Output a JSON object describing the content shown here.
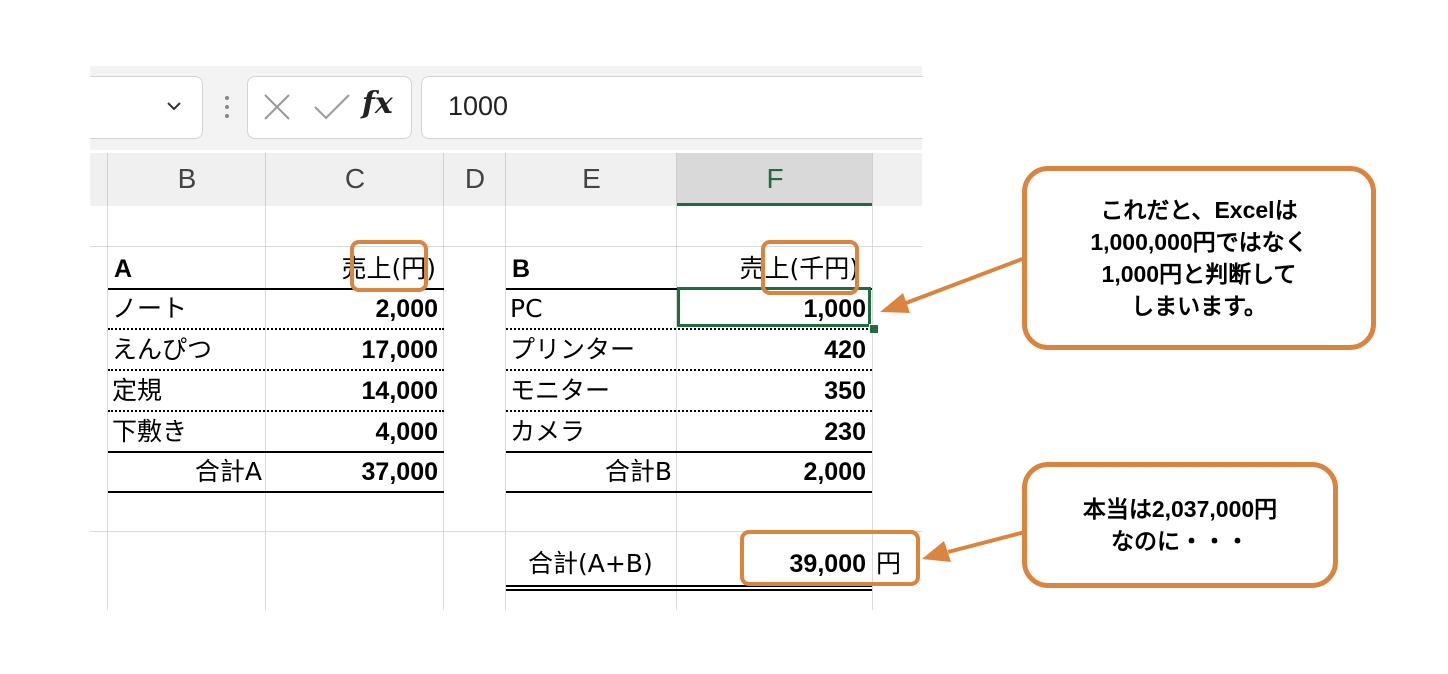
{
  "formula_bar": {
    "name_box_dropdown_icon": "chevron-down-icon",
    "cancel_icon": "x-icon",
    "enter_icon": "checkmark-icon",
    "function_label": "fx",
    "value": "1000"
  },
  "columns": [
    {
      "label": "B",
      "selected": false
    },
    {
      "label": "C",
      "selected": false
    },
    {
      "label": "D",
      "selected": false
    },
    {
      "label": "E",
      "selected": false
    },
    {
      "label": "F",
      "selected": true
    }
  ],
  "table_a": {
    "title": "A",
    "header": "売上(円)",
    "rows": [
      {
        "name": "ノート",
        "value": "2,000"
      },
      {
        "name": "えんぴつ",
        "value": "17,000"
      },
      {
        "name": "定規",
        "value": "14,000"
      },
      {
        "name": "下敷き",
        "value": "4,000"
      }
    ],
    "total_label": "合計A",
    "total_value": "37,000"
  },
  "table_b": {
    "title": "B",
    "header": "売上(千円)",
    "rows": [
      {
        "name": "PC",
        "value": "1,000"
      },
      {
        "name": "プリンター",
        "value": "420"
      },
      {
        "name": "モニター",
        "value": "350"
      },
      {
        "name": "カメラ",
        "value": "230"
      }
    ],
    "total_label": "合計B",
    "total_value": "2,000"
  },
  "grand_total": {
    "label": "合計(A+B)",
    "value": "39,000",
    "unit": "円"
  },
  "callouts": {
    "top": [
      "これだと、Excelは",
      "1,000,000円ではなく",
      "1,000円と判断して",
      "しまいます。"
    ],
    "bottom": [
      "本当は2,037,000円",
      "なのに・・・"
    ]
  },
  "colors": {
    "accent_orange": "#d98540",
    "excel_green": "#1e6c3f"
  }
}
